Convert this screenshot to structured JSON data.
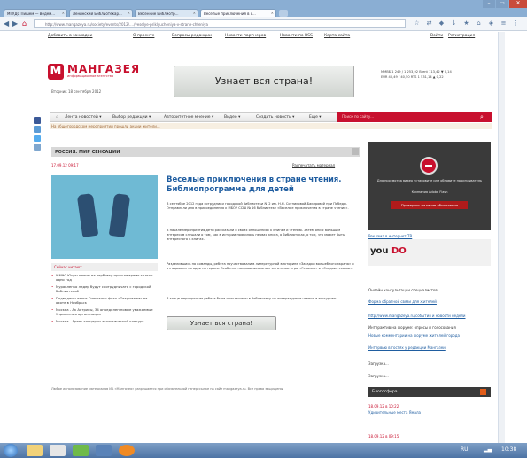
{
  "browser": {
    "tabs": [
      {
        "label": "МГУДС Пишем — Ведем..."
      },
      {
        "label": "Ленинский Библиотекар..."
      },
      {
        "label": "Весенние Библиотр..."
      },
      {
        "label": "Веселые приключения в с..."
      }
    ],
    "url": "http://www.mangazeya.ru/society/events/2012/..../veselye-priklyucheniya-v-strane-chteniya",
    "window_controls": [
      "–",
      "▭",
      "✕"
    ]
  },
  "site_nav": {
    "items": [
      "Добавить в закладки",
      "О проекте",
      "Вопросы редакции",
      "Новости партнеров",
      "Новости по RSS",
      "Карта сайта"
    ],
    "right_items": [
      "Войти",
      "Регистрация"
    ]
  },
  "header": {
    "logo_letter": "М",
    "brand": "МАНГАЗЕЯ",
    "brand_sub": "информационное агентство",
    "date": "Вторник 18 сентября 2012",
    "banner_text": "Узнает вся страна!",
    "quotes": [
      "ММВБ 1 249 / 1 253,92  Brent 113,42 ▼ 0,14",
      "EUR 40,49 / 40,50  RTS 1 531,14 ▲ 0,22"
    ]
  },
  "menu": {
    "items": [
      "Лента новостей ▾",
      "Выбор редакции ▾",
      "Авторитетное мнение ▾",
      "Видео ▾",
      "Создать новость ▾",
      "Еще ▾"
    ],
    "search_placeholder": "Поиск по сайту...",
    "ticker": "На общегородском мероприятии прошли акции жители..."
  },
  "section": {
    "header": "РОССИЯ: МИР СЕНСАЦИИ",
    "date": "17.09.12 09:17",
    "print_link": "Распечатать материал"
  },
  "article": {
    "title": "Веселые приключения в стране чтения. Библиопрограмма для детей",
    "paragraphs": [
      "В сентябре 2012 года сотрудники городской библиотеки № 2 им. Н.Н. Сотниковой-Бакировой при Победы. Отправляли для в присоединения к МБОУ ССШ № 16 библиотеку «Веселые приключения в стране чтения».",
      "В начале мероприятия дети рассказали о своих отношениях к книгам и чтению. Затем они с большим интересом слушали о том, как в истории появилась первая книга, о библиотеках, о том, что может быть интересного в книгах.",
      "Разделившись на команды, ребята поучаствовали в литературной викторине «Загадки волшебного экрана» и отгадывали загадки на героев. Особенно понравились юным читателям игры «Герасим» и «Сладкие сказки».",
      "В конце мероприятия ребята были приглашены в библиотеку на литературные чтения и экскурсию."
    ],
    "banner_text": "Узнает вся страна!",
    "footer": "Любое использование материалов ИА «Мангазея» разрешается при обязательной гиперссылке на сайт mangazeya.ru. Все права защищены."
  },
  "sidebar_read": {
    "header": "Сейчас читают",
    "items": [
      "У МЧС Югры планы на вербовку прошли время только одно год",
      "Муравленко лидер будут соотрудничать с городской библиотекой",
      "Подведены итоги Сиянского фото «Открываем» на охоте в Ноябрьск",
      "Москва - Ак Актрисы, 34 определен новые уважаемые Управления организации",
      "Москва - Аренс концерты экологический конкурс"
    ]
  },
  "right": {
    "ad_text_1": "Для просмотра видео установите или обновите проигрыватель",
    "ad_text_2": "Компания Adobe Flash",
    "ad_button": "Проверить наличие обновления",
    "ad_link": "Реклама в интернет-ТВ",
    "youdo_1": "you",
    "youdo_2": "DO",
    "links": [
      {
        "text": "Онлайн консультации специалистов",
        "kind": "text"
      },
      {
        "text": "Форма обратной связи для жителей",
        "kind": "link"
      },
      {
        "text": "http://www.mangazeya.ru/события и новости недели",
        "kind": "link"
      },
      {
        "text": "Интерактив на форуме: опросы и голосования",
        "kind": "text"
      },
      {
        "text": "Новые комментарии на форуме жителей города",
        "kind": "link"
      },
      {
        "text": "Интервью в гостях у редакции Мангазеи",
        "kind": "link"
      },
      {
        "text": "Загрузка...",
        "kind": "text"
      },
      {
        "text": "Загрузка...",
        "kind": "text"
      }
    ],
    "blog_header": "Блогосфера",
    "blog_items": [
      "18.09.12 в 10:22",
      "Удивительные места Ямала",
      "18.09.12 в 09:15"
    ]
  },
  "taskbar": {
    "clock": "10:38",
    "lang": "RU"
  },
  "colors": {
    "brand": "#c8102e",
    "link": "#1f5da0",
    "tabbar": "#8aaed3",
    "taskbar": "#4d73a4"
  }
}
